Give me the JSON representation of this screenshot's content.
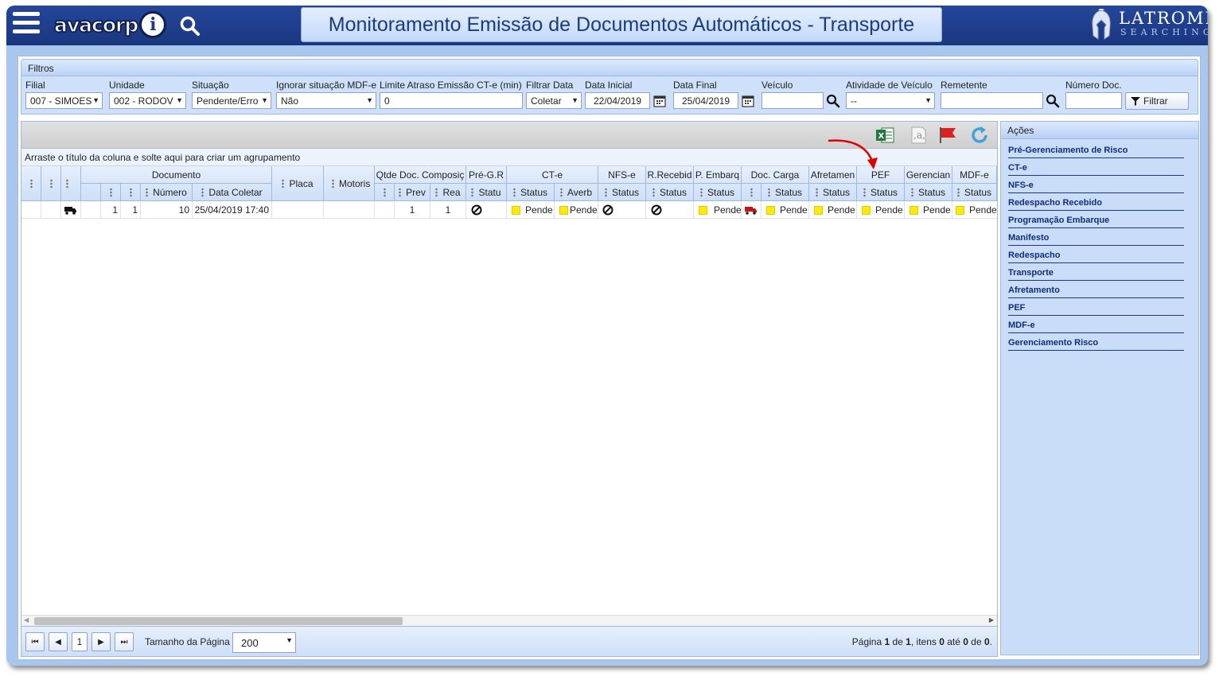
{
  "app": {
    "logo_text": "avacorp",
    "title": "Monitoramento Emissão de Documentos Automáticos - Transporte",
    "brand_name": "LATROMI",
    "brand_sub": "SEARCHING"
  },
  "filters": {
    "header": "Filtros",
    "filial": {
      "label": "Filial",
      "value": "007 - SIMOES"
    },
    "unidade": {
      "label": "Unidade",
      "value": "002 - RODOV"
    },
    "situacao": {
      "label": "Situação",
      "value": "Pendente/Erro"
    },
    "ignorar": {
      "label": "Ignorar situação MDF-e",
      "value": "Não"
    },
    "limite": {
      "label": "Limite Atraso Emissão CT-e (min)",
      "value": "0"
    },
    "filtrar_data": {
      "label": "Filtrar Data",
      "value": "Coletar"
    },
    "data_inicial": {
      "label": "Data Inicial",
      "value": "22/04/2019"
    },
    "data_final": {
      "label": "Data Final",
      "value": "25/04/2019"
    },
    "veiculo": {
      "label": "Veículo",
      "value": ""
    },
    "atividade": {
      "label": "Atividade de Veículo",
      "value": "--"
    },
    "remetente": {
      "label": "Remetente",
      "value": ""
    },
    "numero_doc": {
      "label": "Número Doc.",
      "value": ""
    },
    "filtrar_button": "Filtrar"
  },
  "grid": {
    "group_hint": "Arraste o título da coluna e solte aqui para criar um agrupamento",
    "headers_top": {
      "documento": "Documento",
      "placa": "Placa",
      "motorista": "Motoris",
      "qtde": "Qtde Doc. Composiç",
      "preg": "Pré-G.R",
      "cte": "CT-e",
      "nfse": "NFS-e",
      "rrecebido": "R.Recebid",
      "pembarque": "P. Embarq",
      "doccarga": "Doc. Carga",
      "afretamento": "Afretamen",
      "pef": "PEF",
      "gerenciamento": "Gerencian",
      "mdfe": "MDF-e"
    },
    "headers_bottom": {
      "numero": "Número",
      "data_coletar": "Data Coletar",
      "prev": "Prev",
      "rea": "Rea",
      "preg_status": "Statu",
      "cte_status": "Status",
      "cte_averb": "Averb",
      "nfse_status": "Status",
      "rrec_status": "Status",
      "pemb_status": "Status",
      "doc_status": "Status",
      "afr_status": "Status",
      "pef_status": "Status",
      "ger_status": "Status",
      "mdfe_status": "Status"
    },
    "row": {
      "c1": "1",
      "c2": "1",
      "numero": "10",
      "data_coletar": "25/04/2019 17:40",
      "prev": "1",
      "rea": "1",
      "cte_status": "Pende",
      "cte_averb": "Pende",
      "pemb_status": "Pende",
      "doc_status": "Pende",
      "afr_status": "Pende",
      "pef_status": "Pende",
      "ger_status": "Pende",
      "mdfe_status": "Pende"
    },
    "pager": {
      "current_page": "1",
      "page_size_label": "Tamanho da Página",
      "page_size": "200",
      "info_prefix": "Página ",
      "info_page": "1",
      "info_de": " de ",
      "info_total_pages": "1",
      "info_itens": ", itens ",
      "info_from": "0",
      "info_ate": " até ",
      "info_to": "0",
      "info_de2": " de ",
      "info_total": "0",
      "info_end": "."
    }
  },
  "actions": {
    "header": "Ações",
    "items": [
      "Pré-Gerenciamento de Risco",
      "CT-e",
      "NFS-e",
      "Redespacho Recebido",
      "Programação Embarque",
      "Manifesto",
      "Redespacho",
      "Transporte",
      "Afretamento",
      "PEF",
      "MDF-e",
      "Gerenciamento Risco"
    ]
  },
  "colors": {
    "topbar": "#1f3f8f",
    "panel": "#c9dcf8",
    "pending": "#ffeb00",
    "annotation_arrow": "#e00000",
    "excel": "#1d7a3a",
    "flag": "#e02020",
    "refresh": "#3aa3e0"
  },
  "icons": [
    "menu-icon",
    "search-icon",
    "calendar-icon",
    "excel-icon",
    "text-icon",
    "flag-icon",
    "refresh-icon",
    "truck-icon",
    "blocked-icon",
    "filter-icon"
  ]
}
